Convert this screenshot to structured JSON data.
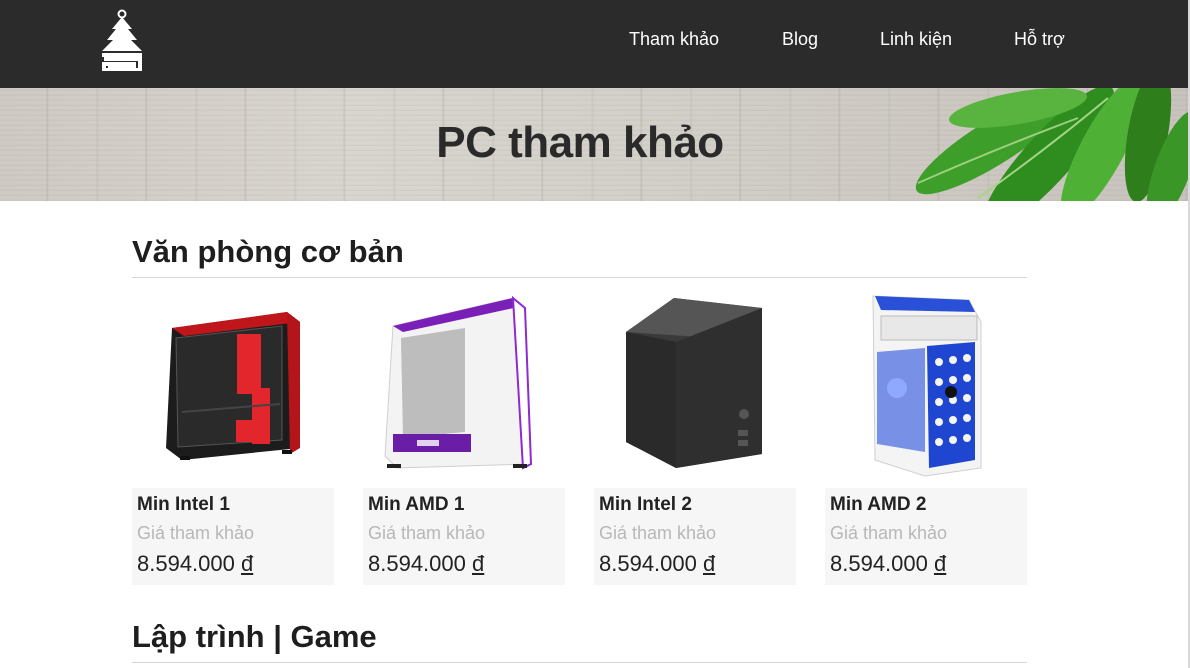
{
  "nav": {
    "links": [
      "Tham khảo",
      "Blog",
      "Linh kiện",
      "Hỗ trợ"
    ]
  },
  "banner": {
    "title": "PC tham khảo"
  },
  "sections": [
    {
      "title": "Văn phòng cơ bản",
      "products": [
        {
          "name": "Min Intel 1",
          "subtitle": "Giá tham khảo",
          "price": "8.594.000",
          "currency": "đ",
          "image": "case-black-red"
        },
        {
          "name": "Min AMD 1",
          "subtitle": "Giá tham khảo",
          "price": "8.594.000",
          "currency": "đ",
          "image": "case-white-purple"
        },
        {
          "name": "Min Intel 2",
          "subtitle": "Giá tham khảo",
          "price": "8.594.000",
          "currency": "đ",
          "image": "case-black-mesh"
        },
        {
          "name": "Min AMD 2",
          "subtitle": "Giá tham khảo",
          "price": "8.594.000",
          "currency": "đ",
          "image": "case-white-blue"
        }
      ]
    },
    {
      "title": "Lập trình | Game"
    }
  ],
  "colors": {
    "navbar": "#2b2b2b",
    "card_bg": "#f6f6f6",
    "subtitle": "#b7b7b7"
  }
}
